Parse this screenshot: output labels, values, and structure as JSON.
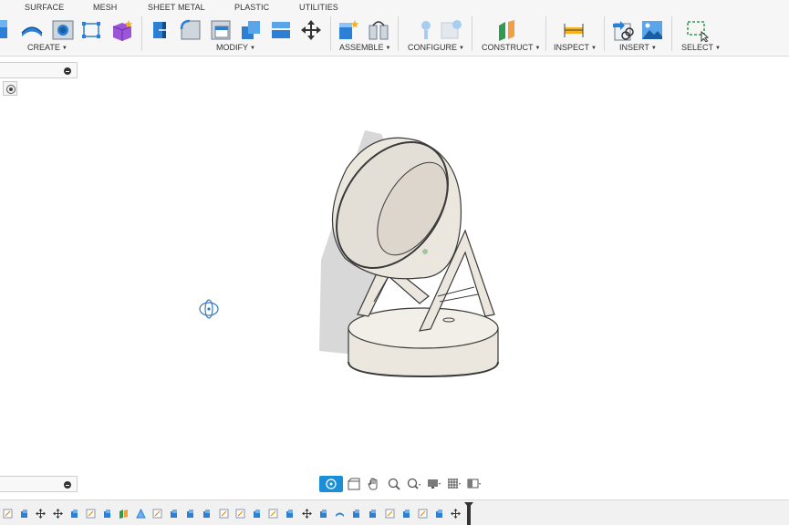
{
  "toolbar": {
    "tabs": [
      "SURFACE",
      "MESH",
      "SHEET METAL",
      "PLASTIC",
      "UTILITIES"
    ],
    "groups": {
      "create": "CREATE",
      "modify": "MODIFY",
      "assemble": "ASSEMBLE",
      "configure": "CONFIGURE",
      "construct": "CONSTRUCT",
      "inspect": "INSPECT",
      "insert": "INSERT",
      "select": "SELECT"
    },
    "icons": {
      "create": [
        "extrude-icon",
        "revolve-icon",
        "hole-icon",
        "sketch-icon",
        "form-icon"
      ],
      "modify": [
        "press-pull-icon",
        "fillet-icon",
        "shell-icon",
        "combine-icon",
        "split-icon",
        "move-icon"
      ],
      "assemble": [
        "new-component-icon",
        "joint-icon"
      ],
      "configure": [
        "configure-table-icon",
        "configure-rule-icon"
      ],
      "construct": [
        "offset-plane-icon"
      ],
      "inspect": [
        "measure-icon"
      ],
      "insert": [
        "insert-link-icon",
        "insert-image-icon"
      ],
      "select": [
        "selection-window-icon"
      ]
    }
  },
  "colors": {
    "accent": "#1a8ed6",
    "toolbar_bg": "#f6f6f6",
    "model_fill": "#ebe7df",
    "model_stroke": "#3a3a3a",
    "shadow": "#d6d6d6"
  },
  "navbar": {
    "tools": [
      "orbit-icon",
      "look-at-icon",
      "pan-icon",
      "zoom-window-icon",
      "zoom-icon",
      "display-settings-icon",
      "grid-icon",
      "viewports-icon"
    ]
  },
  "timeline": {
    "items": [
      "sketch",
      "extrude",
      "move",
      "move",
      "extrude",
      "sketch",
      "extrude",
      "plane",
      "triangle",
      "sketch",
      "extrude",
      "extrude",
      "extrude",
      "sketch",
      "sketch",
      "extrude",
      "sketch",
      "extrude",
      "move",
      "extrude",
      "revolve",
      "extrude",
      "extrude",
      "sketch",
      "extrude",
      "sketch",
      "extrude",
      "move"
    ]
  }
}
